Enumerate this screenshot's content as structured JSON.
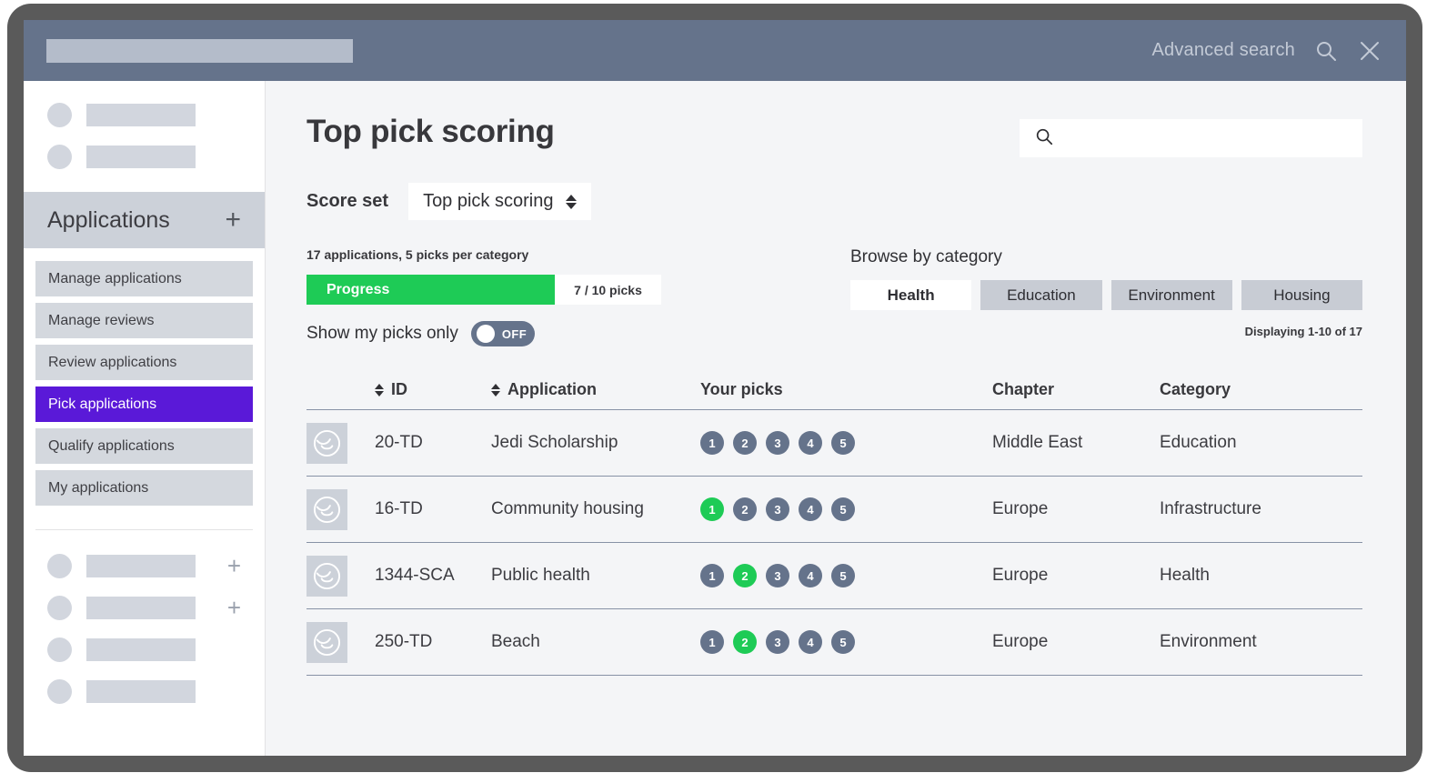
{
  "topbar": {
    "advanced_search_label": "Advanced search",
    "search_icon": "search-icon",
    "close_icon": "close-icon",
    "field_value": ""
  },
  "sidebar": {
    "top_placeholders": [
      {
        "has_plus": false
      },
      {
        "has_plus": false
      }
    ],
    "section": {
      "title": "Applications",
      "add_label": "+"
    },
    "items": [
      {
        "label": "Manage applications",
        "active": false
      },
      {
        "label": "Manage reviews",
        "active": false
      },
      {
        "label": "Review applications",
        "active": false
      },
      {
        "label": "Pick applications",
        "active": true
      },
      {
        "label": "Qualify applications",
        "active": false
      },
      {
        "label": "My applications",
        "active": false
      }
    ],
    "bottom_placeholders": [
      {
        "has_plus": true
      },
      {
        "has_plus": true
      },
      {
        "has_plus": false
      },
      {
        "has_plus": false
      }
    ]
  },
  "main": {
    "page_title": "Top pick scoring",
    "search": {
      "value": "",
      "placeholder": "",
      "icon": "search-icon"
    },
    "score_set": {
      "label": "Score set",
      "selected": "Top pick scoring"
    },
    "picks_meta": "17 applications, 5 picks per category",
    "progress": {
      "label": "Progress",
      "count": "7 / 10 picks",
      "percent": 70,
      "fill_color": "#1ecb56"
    },
    "show_my_picks": {
      "label": "Show my picks only",
      "state": "OFF",
      "on": false
    },
    "browse": {
      "label": "Browse by category",
      "tabs": [
        {
          "label": "Health",
          "active": true
        },
        {
          "label": "Education",
          "active": false
        },
        {
          "label": "Environment",
          "active": false
        },
        {
          "label": "Housing",
          "active": false
        }
      ]
    },
    "displaying": "Displaying 1-10 of 17",
    "table": {
      "columns": [
        {
          "key": "avatar",
          "label": "",
          "sortable": false
        },
        {
          "key": "id",
          "label": "ID",
          "sortable": true
        },
        {
          "key": "application",
          "label": "Application",
          "sortable": true
        },
        {
          "key": "picks",
          "label": "Your picks",
          "sortable": false
        },
        {
          "key": "chapter",
          "label": "Chapter",
          "sortable": false
        },
        {
          "key": "category",
          "label": "Category",
          "sortable": false
        }
      ],
      "pick_options": [
        "1",
        "2",
        "3",
        "4",
        "5"
      ],
      "rows": [
        {
          "avatar_icon": "avatar-smiley-icon",
          "id": "20-TD",
          "application": "Jedi Scholarship",
          "picked": null,
          "chapter": "Middle East",
          "category": "Education"
        },
        {
          "avatar_icon": "avatar-smiley-icon",
          "id": "16-TD",
          "application": "Community housing",
          "picked": "1",
          "chapter": "Europe",
          "category": "Infrastructure"
        },
        {
          "avatar_icon": "avatar-smiley-icon",
          "id": "1344-SCA",
          "application": "Public health",
          "picked": "2",
          "chapter": "Europe",
          "category": "Health"
        },
        {
          "avatar_icon": "avatar-smiley-icon",
          "id": "250-TD",
          "application": "Beach",
          "picked": "2",
          "chapter": "Europe",
          "category": "Environment"
        }
      ]
    }
  },
  "colors": {
    "topbar": "#65738b",
    "accent_purple": "#5a19d8",
    "progress_green": "#1ecb56",
    "pick_gray": "#65738b",
    "frame": "#5a5a5a"
  }
}
